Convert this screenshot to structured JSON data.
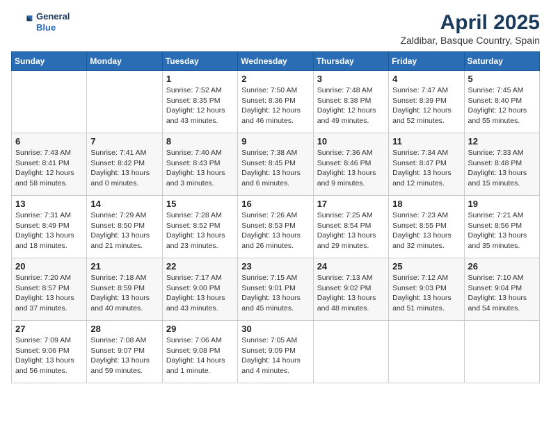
{
  "logo": {
    "line1": "General",
    "line2": "Blue"
  },
  "title": "April 2025",
  "subtitle": "Zaldibar, Basque Country, Spain",
  "weekdays": [
    "Sunday",
    "Monday",
    "Tuesday",
    "Wednesday",
    "Thursday",
    "Friday",
    "Saturday"
  ],
  "weeks": [
    [
      {
        "day": "",
        "info": ""
      },
      {
        "day": "",
        "info": ""
      },
      {
        "day": "1",
        "info": "Sunrise: 7:52 AM\nSunset: 8:35 PM\nDaylight: 12 hours and 43 minutes."
      },
      {
        "day": "2",
        "info": "Sunrise: 7:50 AM\nSunset: 8:36 PM\nDaylight: 12 hours and 46 minutes."
      },
      {
        "day": "3",
        "info": "Sunrise: 7:48 AM\nSunset: 8:38 PM\nDaylight: 12 hours and 49 minutes."
      },
      {
        "day": "4",
        "info": "Sunrise: 7:47 AM\nSunset: 8:39 PM\nDaylight: 12 hours and 52 minutes."
      },
      {
        "day": "5",
        "info": "Sunrise: 7:45 AM\nSunset: 8:40 PM\nDaylight: 12 hours and 55 minutes."
      }
    ],
    [
      {
        "day": "6",
        "info": "Sunrise: 7:43 AM\nSunset: 8:41 PM\nDaylight: 12 hours and 58 minutes."
      },
      {
        "day": "7",
        "info": "Sunrise: 7:41 AM\nSunset: 8:42 PM\nDaylight: 13 hours and 0 minutes."
      },
      {
        "day": "8",
        "info": "Sunrise: 7:40 AM\nSunset: 8:43 PM\nDaylight: 13 hours and 3 minutes."
      },
      {
        "day": "9",
        "info": "Sunrise: 7:38 AM\nSunset: 8:45 PM\nDaylight: 13 hours and 6 minutes."
      },
      {
        "day": "10",
        "info": "Sunrise: 7:36 AM\nSunset: 8:46 PM\nDaylight: 13 hours and 9 minutes."
      },
      {
        "day": "11",
        "info": "Sunrise: 7:34 AM\nSunset: 8:47 PM\nDaylight: 13 hours and 12 minutes."
      },
      {
        "day": "12",
        "info": "Sunrise: 7:33 AM\nSunset: 8:48 PM\nDaylight: 13 hours and 15 minutes."
      }
    ],
    [
      {
        "day": "13",
        "info": "Sunrise: 7:31 AM\nSunset: 8:49 PM\nDaylight: 13 hours and 18 minutes."
      },
      {
        "day": "14",
        "info": "Sunrise: 7:29 AM\nSunset: 8:50 PM\nDaylight: 13 hours and 21 minutes."
      },
      {
        "day": "15",
        "info": "Sunrise: 7:28 AM\nSunset: 8:52 PM\nDaylight: 13 hours and 23 minutes."
      },
      {
        "day": "16",
        "info": "Sunrise: 7:26 AM\nSunset: 8:53 PM\nDaylight: 13 hours and 26 minutes."
      },
      {
        "day": "17",
        "info": "Sunrise: 7:25 AM\nSunset: 8:54 PM\nDaylight: 13 hours and 29 minutes."
      },
      {
        "day": "18",
        "info": "Sunrise: 7:23 AM\nSunset: 8:55 PM\nDaylight: 13 hours and 32 minutes."
      },
      {
        "day": "19",
        "info": "Sunrise: 7:21 AM\nSunset: 8:56 PM\nDaylight: 13 hours and 35 minutes."
      }
    ],
    [
      {
        "day": "20",
        "info": "Sunrise: 7:20 AM\nSunset: 8:57 PM\nDaylight: 13 hours and 37 minutes."
      },
      {
        "day": "21",
        "info": "Sunrise: 7:18 AM\nSunset: 8:59 PM\nDaylight: 13 hours and 40 minutes."
      },
      {
        "day": "22",
        "info": "Sunrise: 7:17 AM\nSunset: 9:00 PM\nDaylight: 13 hours and 43 minutes."
      },
      {
        "day": "23",
        "info": "Sunrise: 7:15 AM\nSunset: 9:01 PM\nDaylight: 13 hours and 45 minutes."
      },
      {
        "day": "24",
        "info": "Sunrise: 7:13 AM\nSunset: 9:02 PM\nDaylight: 13 hours and 48 minutes."
      },
      {
        "day": "25",
        "info": "Sunrise: 7:12 AM\nSunset: 9:03 PM\nDaylight: 13 hours and 51 minutes."
      },
      {
        "day": "26",
        "info": "Sunrise: 7:10 AM\nSunset: 9:04 PM\nDaylight: 13 hours and 54 minutes."
      }
    ],
    [
      {
        "day": "27",
        "info": "Sunrise: 7:09 AM\nSunset: 9:06 PM\nDaylight: 13 hours and 56 minutes."
      },
      {
        "day": "28",
        "info": "Sunrise: 7:08 AM\nSunset: 9:07 PM\nDaylight: 13 hours and 59 minutes."
      },
      {
        "day": "29",
        "info": "Sunrise: 7:06 AM\nSunset: 9:08 PM\nDaylight: 14 hours and 1 minute."
      },
      {
        "day": "30",
        "info": "Sunrise: 7:05 AM\nSunset: 9:09 PM\nDaylight: 14 hours and 4 minutes."
      },
      {
        "day": "",
        "info": ""
      },
      {
        "day": "",
        "info": ""
      },
      {
        "day": "",
        "info": ""
      }
    ]
  ]
}
